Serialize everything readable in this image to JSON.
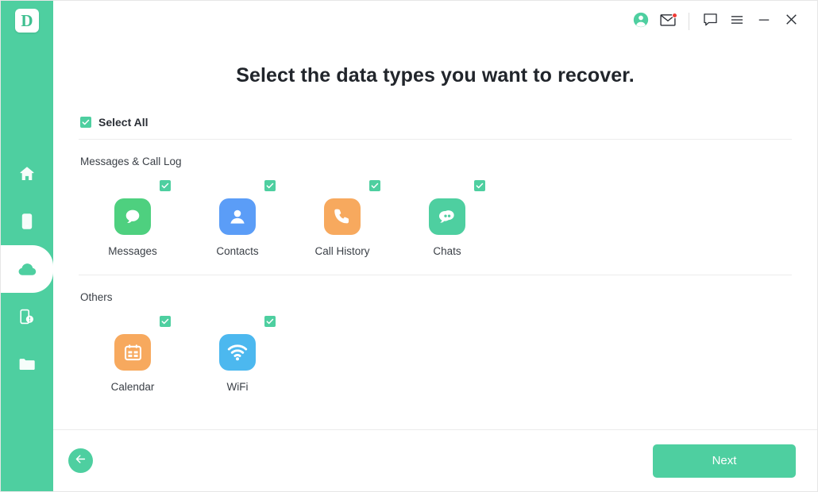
{
  "app": {
    "logo_letter": "D",
    "brand_color": "#4ecfa0"
  },
  "titlebar": {
    "buttons": [
      {
        "name": "account-icon",
        "label": "Account"
      },
      {
        "name": "mail-icon",
        "label": "Messages",
        "badge": true
      },
      {
        "name": "feedback-icon",
        "label": "Feedback"
      },
      {
        "name": "menu-icon",
        "label": "Menu"
      },
      {
        "name": "minimize-icon",
        "label": "Minimize"
      },
      {
        "name": "close-icon",
        "label": "Close"
      }
    ]
  },
  "sidebar": {
    "items": [
      {
        "name": "sidebar-item-home",
        "icon": "home-icon",
        "label": "Home",
        "active": false
      },
      {
        "name": "sidebar-item-device",
        "icon": "phone-icon",
        "label": "Device",
        "active": false
      },
      {
        "name": "sidebar-item-cloud",
        "icon": "cloud-icon",
        "label": "Cloud",
        "active": true
      },
      {
        "name": "sidebar-item-repair",
        "icon": "device-repair-icon",
        "label": "Repair",
        "active": false
      },
      {
        "name": "sidebar-item-files",
        "icon": "folder-icon",
        "label": "Files",
        "active": false
      }
    ]
  },
  "main": {
    "title": "Select the data types you want to recover.",
    "select_all": {
      "label": "Select All",
      "checked": true
    },
    "sections": [
      {
        "title": "Messages & Call Log",
        "items": [
          {
            "label": "Messages",
            "icon": "messages-icon",
            "color": "#4ed07f",
            "checked": true
          },
          {
            "label": "Contacts",
            "icon": "contacts-icon",
            "color": "#5b9df7",
            "checked": true
          },
          {
            "label": "Call History",
            "icon": "call-history-icon",
            "color": "#f7a95e",
            "checked": true
          },
          {
            "label": "Chats",
            "icon": "chats-icon",
            "color": "#4ecfa0",
            "checked": true
          }
        ]
      },
      {
        "title": "Others",
        "items": [
          {
            "label": "Calendar",
            "icon": "calendar-icon",
            "color": "#f7a95e",
            "checked": true
          },
          {
            "label": "WiFi",
            "icon": "wifi-icon",
            "color": "#4cb8ef",
            "checked": true
          }
        ]
      }
    ]
  },
  "footer": {
    "back_label": "Back",
    "next_label": "Next"
  }
}
